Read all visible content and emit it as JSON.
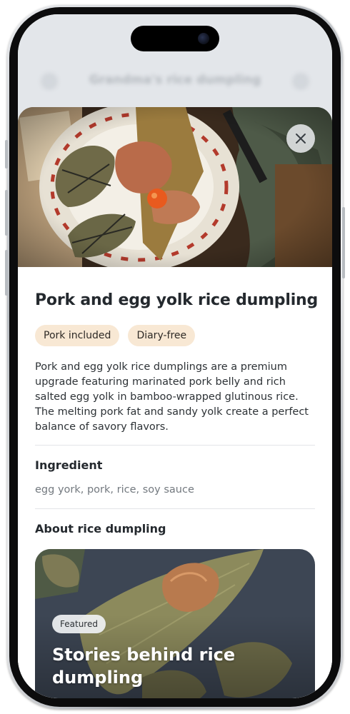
{
  "background_page": {
    "title": "Grandma's rice dumpling",
    "back_icon": "chevron-left-icon",
    "favorite_icon": "heart-icon"
  },
  "sheet": {
    "close_icon": "close-icon",
    "title": "Pork and egg yolk rice dumpling",
    "tags": [
      "Pork included",
      "Diary-free"
    ],
    "description": "Pork and egg yolk rice dumplings are a premium upgrade featuring marinated pork belly and rich salted egg yolk in bamboo-wrapped glutinous rice. The melting pork fat and sandy yolk create a perfect balance of savory flavors.",
    "ingredient_heading": "Ingredient",
    "ingredients": "egg york, pork, rice, soy sauce",
    "about_heading": "About rice dumpling",
    "featured_card": {
      "badge": "Featured",
      "title": "Stories behind rice dumpling"
    }
  },
  "colors": {
    "chip_bg": "#f8e8d4",
    "text_primary": "#24292e",
    "text_secondary": "#73797f",
    "sheet_overlay": "#e3e6ea"
  }
}
